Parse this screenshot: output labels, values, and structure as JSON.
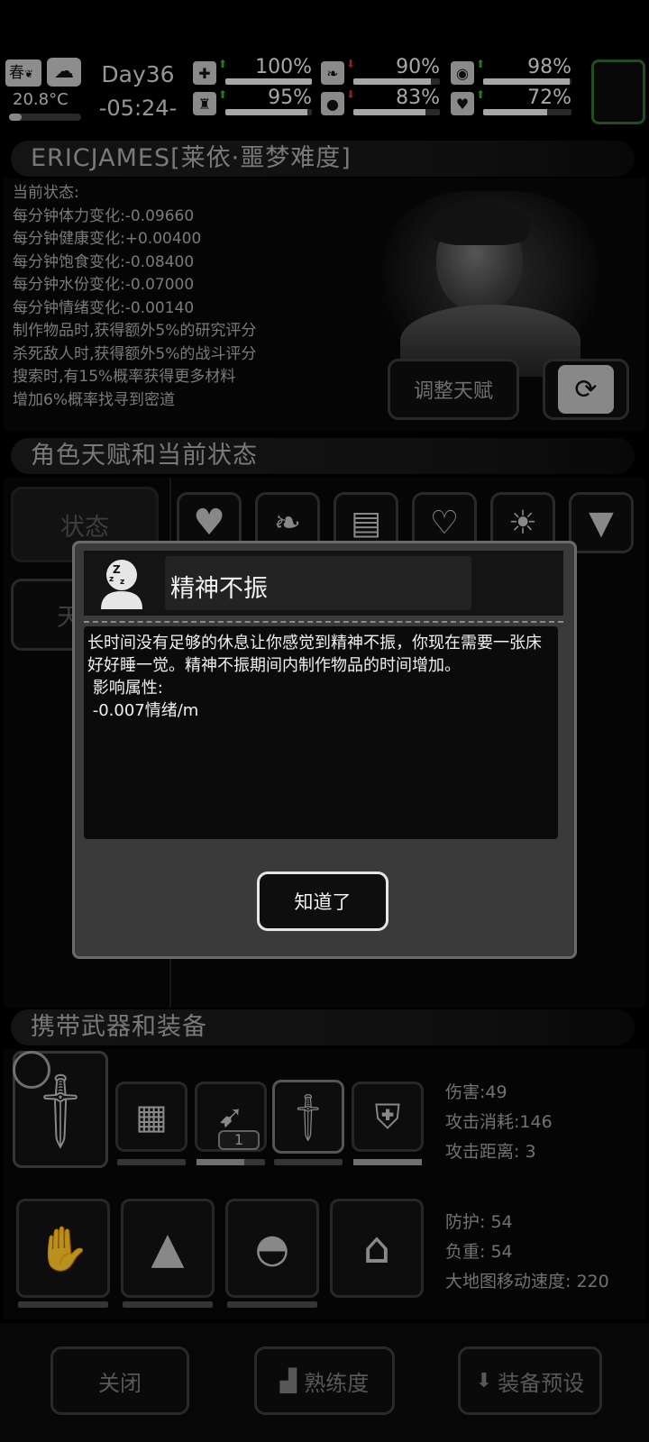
{
  "hud": {
    "season": "春",
    "temperature": "20.8°C",
    "day": "Day36",
    "time": "-05:24-",
    "stats": [
      {
        "icon": "medkit-icon",
        "glyph": "✚",
        "trend": "up",
        "pct": "100%",
        "value": 1.0
      },
      {
        "icon": "stomach-icon",
        "glyph": "❧",
        "trend": "down",
        "pct": "90%",
        "value": 0.9
      },
      {
        "icon": "brain-icon",
        "glyph": "◉",
        "trend": "up",
        "pct": "98%",
        "value": 0.98
      },
      {
        "icon": "boot-icon",
        "glyph": "♜",
        "trend": "up",
        "pct": "95%",
        "value": 0.95
      },
      {
        "icon": "water-drop-icon",
        "glyph": "●",
        "trend": "down",
        "pct": "83%",
        "value": 0.83
      },
      {
        "icon": "heart-icon",
        "glyph": "♥",
        "trend": "up",
        "pct": "72%",
        "value": 0.72
      }
    ]
  },
  "character": {
    "name": "ERICJAMES[莱依·噩梦难度]",
    "lines": [
      "当前状态:",
      "每分钟体力变化:-0.09660",
      "每分钟健康变化:+0.00400",
      "每分钟饱食变化:-0.08400",
      "每分钟水份变化:-0.07000",
      "每分钟情绪变化:-0.00140",
      "制作物品时,获得额外5%的研究评分",
      "杀死敌人时,获得额外5%的战斗评分",
      "搜索时,有15%概率获得更多材料",
      "增加6%概率找寻到密道"
    ],
    "adjust_talent_label": "调整天赋"
  },
  "talents": {
    "title": "角色天赋和当前状态",
    "tab_status": "状态",
    "tab_talent": "天"
  },
  "dialog": {
    "title": "精神不振",
    "body_1": "长时间没有足够的休息让你感觉到精神不振，你现在需要一张床好好睡一觉。精神不振期间内制作物品的时间增加。",
    "attr_label": " 影响属性:",
    "attr_value": " -0.007情绪/m",
    "ok_label": "知道了"
  },
  "equipment": {
    "title": "携带武器和装备",
    "weapon_count": "1",
    "weapon_stats": [
      "伤害:49",
      "攻击消耗:146",
      "攻击距离: 3"
    ],
    "armor_stats": [
      "防护: 54",
      "负重: 54",
      "大地图移动速度: 220"
    ]
  },
  "footer": {
    "close_label": "关闭",
    "proficiency_label": "熟练度",
    "preset_label": "装备预设"
  }
}
